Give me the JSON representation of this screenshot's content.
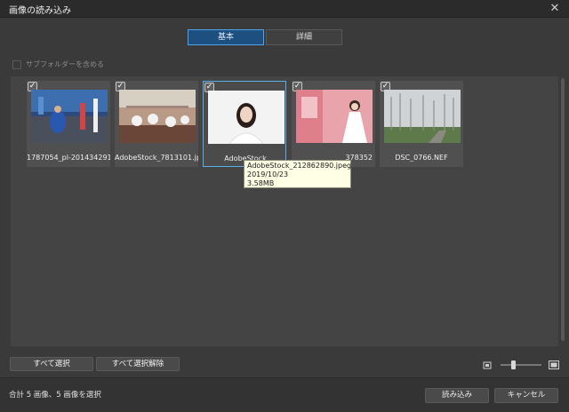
{
  "window": {
    "title": "画像の読み込み",
    "close_icon": "close-icon"
  },
  "tabs": [
    {
      "label": "基本",
      "active": true
    },
    {
      "label": "詳細",
      "active": false
    }
  ],
  "options": {
    "include_subfolders_label": "サブフォルダーを含める",
    "include_subfolders_checked": false
  },
  "thumbnails": [
    {
      "filename": "1787054_pl-2014342915",
      "checked": true,
      "selected": false
    },
    {
      "filename": "AdobeStock_7813101.jp",
      "checked": true,
      "selected": false
    },
    {
      "filename": "AdobeStock",
      "checked": true,
      "selected": true
    },
    {
      "filename": "378352",
      "checked": true,
      "selected": false
    },
    {
      "filename": "DSC_0766.NEF",
      "checked": true,
      "selected": false
    }
  ],
  "tooltip": {
    "name": "AdobeStock_212862890.jpeg",
    "date": "2019/10/23",
    "size": "3.58MB"
  },
  "buttons": {
    "select_all": "すべて選択",
    "deselect_all": "すべて選択解除",
    "import": "読み込み",
    "cancel": "キャンセル"
  },
  "zoom": {
    "level_fraction": 0.3
  },
  "status": {
    "text": "合計 5 画像、5 画像を選択"
  },
  "colors": {
    "accent": "#4fa3ea",
    "tooltip_bg": "#ffffe6"
  }
}
